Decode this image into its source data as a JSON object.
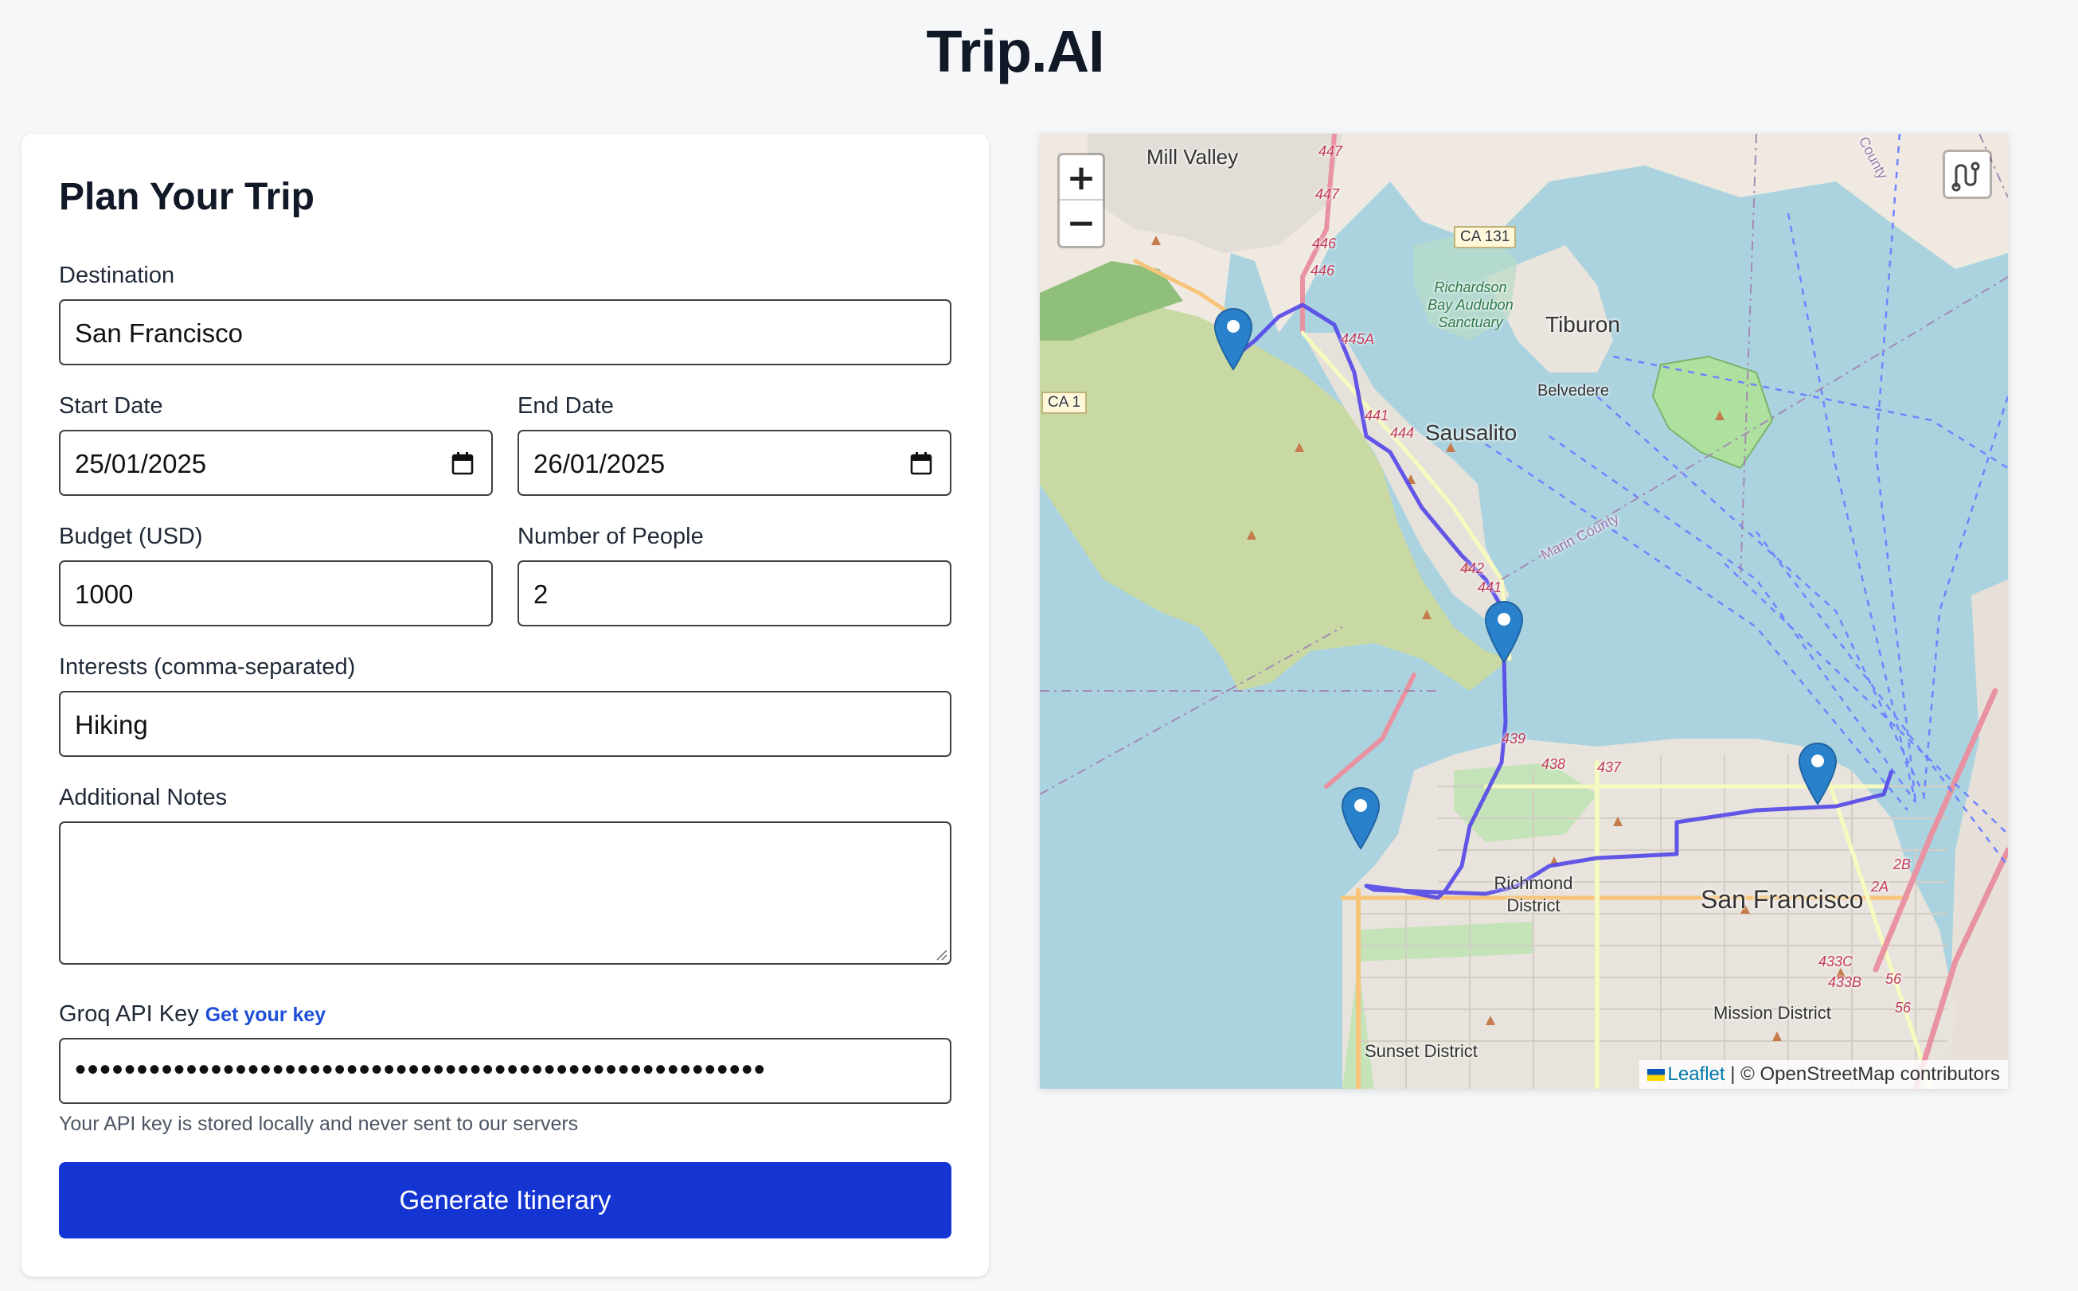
{
  "app": {
    "title": "Trip.AI"
  },
  "form": {
    "title": "Plan Your Trip",
    "destination": {
      "label": "Destination",
      "value": "San Francisco"
    },
    "start_date": {
      "label": "Start Date",
      "value": "25/01/2025"
    },
    "end_date": {
      "label": "End Date",
      "value": "26/01/2025"
    },
    "budget": {
      "label": "Budget (USD)",
      "value": "1000"
    },
    "people": {
      "label": "Number of People",
      "value": "2"
    },
    "interests": {
      "label": "Interests (comma-separated)",
      "value": "Hiking"
    },
    "notes": {
      "label": "Additional Notes",
      "value": ""
    },
    "api_key": {
      "label": "Groq API Key",
      "link": "Get your key",
      "value": "••••••••••••••••••••••••••••••••••••••••••••••••••••••••",
      "hint": "Your API key is stored locally and never sent to our servers"
    },
    "submit_label": "Generate Itinerary"
  },
  "map": {
    "zoom_in": "+",
    "zoom_out": "−",
    "route_icon": "route-icon",
    "marker_icon": "map-pin-icon",
    "route_color": "#5346e8",
    "attribution_link": "Leaflet",
    "attribution_text": "| © OpenStreetMap contributors",
    "labels": {
      "mill_valley": "Mill Valley",
      "tiburon": "Tiburon",
      "belvedere": "Belvedere",
      "sausalito": "Sausalito",
      "richardson": "Richardson Bay Audubon Sanctuary",
      "marin_county": "Marin County",
      "county": "County",
      "ca131": "CA 131",
      "ca1": "CA 1",
      "richmond": "Richmond District",
      "san_francisco": "San Francisco",
      "sunset": "Sunset District",
      "mission": "Mission District",
      "r447a": "447",
      "r447b": "447",
      "r446a": "446",
      "r446b": "446",
      "r445a": "445A",
      "r441": "441",
      "r444": "444",
      "r442": "442",
      "r441b": "441",
      "r439": "439",
      "r438": "438",
      "r437": "437",
      "r2b": "2B",
      "r2a": "2A",
      "r433c": "433C",
      "r433b": "433B",
      "r56a": "56",
      "r56b": "56"
    }
  }
}
